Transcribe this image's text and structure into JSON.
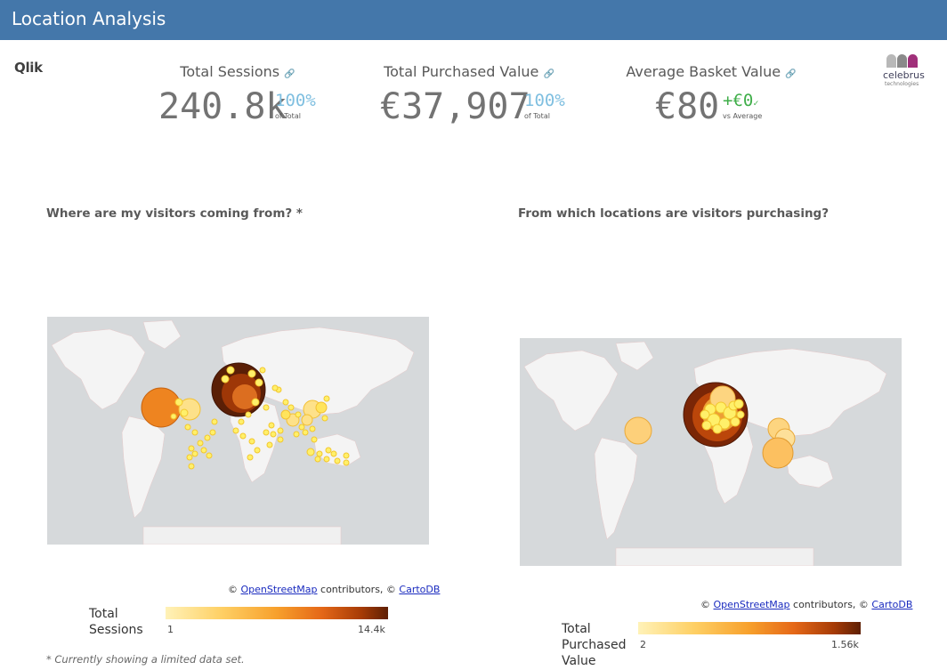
{
  "header": {
    "title": "Location Analysis"
  },
  "logos": {
    "qlik": "Qlik",
    "celebrus_word": "celebrus",
    "celebrus_sub": "technologies"
  },
  "kpis": [
    {
      "label": "Total Sessions",
      "value": "240.8k",
      "pct": "100%",
      "sub": "of Total",
      "icon": "link-icon"
    },
    {
      "label": "Total Purchased Value",
      "value": "€37,907",
      "pct": "100%",
      "sub": "of Total",
      "icon": "link-icon"
    },
    {
      "label": "Average Basket Value",
      "value": "€80",
      "pct": "+€0",
      "sub": "vs Average",
      "icon": "link-icon"
    }
  ],
  "colors": {
    "header": "#4477aa",
    "pct": "#7fbfe0",
    "positive": "#3fae49"
  },
  "left_panel": {
    "title": "Where are my visitors coming from? *",
    "attribution": {
      "prefix": "© ",
      "osm": "OpenStreetMap",
      "middle": " contributors, © ",
      "carto": "CartoDB"
    },
    "legend": {
      "title": "Total Sessions",
      "min": "1",
      "max": "14.4k"
    }
  },
  "right_panel": {
    "title": "From which locations are visitors purchasing?",
    "attribution": {
      "prefix": "© ",
      "osm": "OpenStreetMap",
      "middle": " contributors, © ",
      "carto": "CartoDB"
    },
    "legend": {
      "title": "Total Purchased Value",
      "min": "2",
      "max": "1.56k"
    }
  },
  "footnote": "* Currently showing a limited data set."
}
